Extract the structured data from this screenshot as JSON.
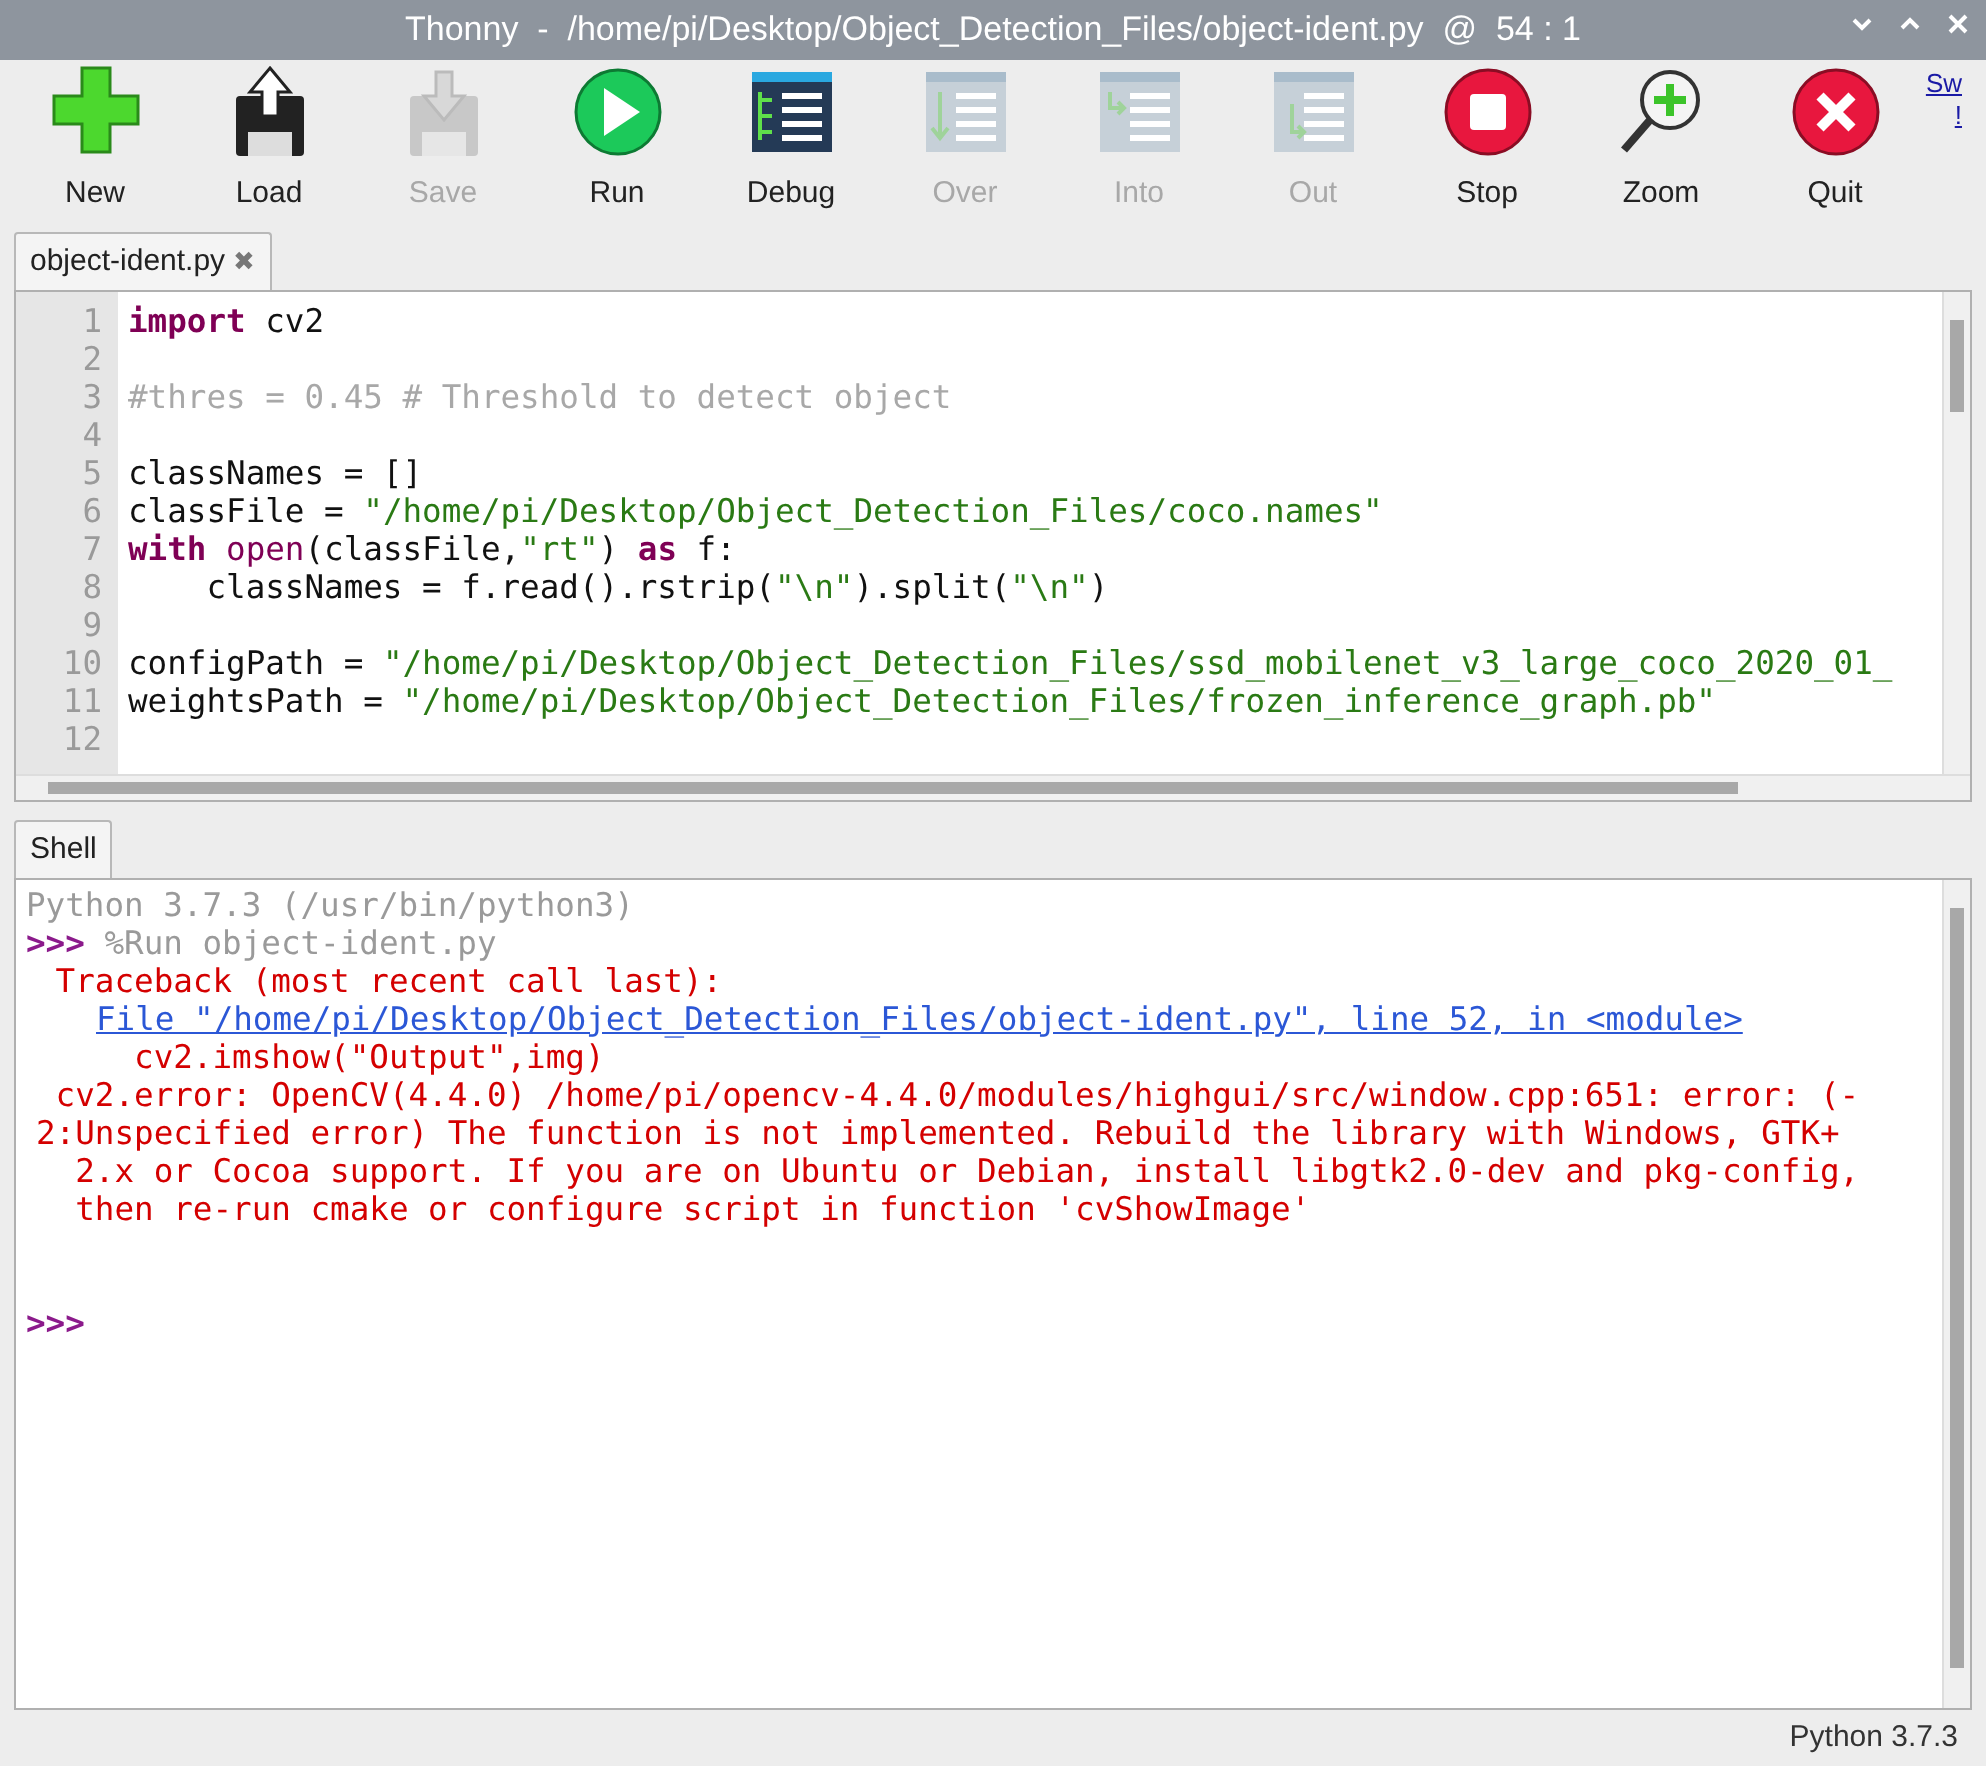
{
  "window": {
    "title": "Thonny  -  /home/pi/Desktop/Object_Detection_Files/object-ident.py  @  54 : 1"
  },
  "toolbar": [
    {
      "kind": "new",
      "label": "New",
      "disabled": false
    },
    {
      "kind": "load",
      "label": "Load",
      "disabled": false
    },
    {
      "kind": "save",
      "label": "Save",
      "disabled": true
    },
    {
      "kind": "run",
      "label": "Run",
      "disabled": false
    },
    {
      "kind": "debug",
      "label": "Debug",
      "disabled": false
    },
    {
      "kind": "over",
      "label": "Over",
      "disabled": true
    },
    {
      "kind": "into",
      "label": "Into",
      "disabled": true
    },
    {
      "kind": "out",
      "label": "Out",
      "disabled": true
    },
    {
      "kind": "stop",
      "label": "Stop",
      "disabled": false
    },
    {
      "kind": "zoom",
      "label": "Zoom",
      "disabled": false
    },
    {
      "kind": "quit",
      "label": "Quit",
      "disabled": false
    }
  ],
  "corner_link": [
    "Sw",
    "!"
  ],
  "editor": {
    "tabs": [
      {
        "label": "object-ident.py",
        "close": "✖",
        "selected": true
      }
    ],
    "lines": [
      {
        "number": "1",
        "tokens": [
          {
            "kind": "keyword",
            "text": "import"
          },
          {
            "kind": "plain",
            "text": " cv2"
          }
        ]
      },
      {
        "number": "2"
      },
      {
        "number": "3",
        "tokens": [
          {
            "kind": "comment",
            "text": "#thres = 0.45 # Threshold to detect object"
          }
        ]
      },
      {
        "number": "4"
      },
      {
        "number": "5",
        "tokens": [
          {
            "kind": "plain",
            "text": "classNames = []"
          }
        ]
      },
      {
        "number": "6",
        "tokens": [
          {
            "kind": "plain",
            "text": "classFile = "
          },
          {
            "kind": "string",
            "text": "\"/home/pi/Desktop/Object_Detection_Files/coco.names\""
          }
        ]
      },
      {
        "number": "7",
        "tokens": [
          {
            "kind": "keyword",
            "text": "with"
          },
          {
            "kind": "builtin",
            "text": " open"
          },
          {
            "kind": "plain",
            "text": "(classFile,"
          },
          {
            "kind": "string",
            "text": "\"rt\""
          },
          {
            "kind": "plain",
            "text": ") "
          },
          {
            "kind": "keyword",
            "text": "as"
          },
          {
            "kind": "plain",
            "text": " f:"
          }
        ]
      },
      {
        "number": "8",
        "tokens": [
          {
            "kind": "plain",
            "text": "    classNames = f.read().rstrip("
          },
          {
            "kind": "string",
            "text": "\"\\n\""
          },
          {
            "kind": "plain",
            "text": ").split("
          },
          {
            "kind": "string",
            "text": "\"\\n\""
          },
          {
            "kind": "plain",
            "text": ")"
          }
        ]
      },
      {
        "number": "9"
      },
      {
        "number": "10",
        "tokens": [
          {
            "kind": "plain",
            "text": "configPath = "
          },
          {
            "kind": "string",
            "text": "\"/home/pi/Desktop/Object_Detection_Files/ssd_mobilenet_v3_large_coco_2020_01_"
          }
        ]
      },
      {
        "number": "11",
        "tokens": [
          {
            "kind": "plain",
            "text": "weightsPath = "
          },
          {
            "kind": "string",
            "text": "\"/home/pi/Desktop/Object_Detection_Files/frozen_inference_graph.pb\""
          }
        ]
      },
      {
        "number": "12"
      }
    ]
  },
  "shell": {
    "tabs": [
      {
        "label": "Shell",
        "selected": true
      }
    ],
    "lines": [
      {
        "kind": "banner",
        "text": "Python 3.7.3 (/usr/bin/python3)"
      },
      {
        "kind": "command",
        "prompt": ">>>",
        "text": "%Run object-ident.py"
      },
      {
        "kind": "error",
        "text": " Traceback (most recent call last):"
      },
      {
        "kind": "link",
        "text": "File \"/home/pi/Desktop/Object_Detection_Files/object-ident.py\", line 52, in <module>"
      },
      {
        "kind": "error",
        "text": "     cv2.imshow(\"Output\",img)"
      },
      {
        "kind": "error",
        "text": " cv2.error: OpenCV(4.4.0) /home/pi/opencv-4.4.0/modules/highgui/src/window.cpp:651: error: (-"
      },
      {
        "kind": "error",
        "text": "2:Unspecified error) The function is not implemented. Rebuild the library with Windows, GTK+"
      },
      {
        "kind": "error",
        "text": "  2.x or Cocoa support. If you are on Ubuntu or Debian, install libgtk2.0-dev and pkg-config,"
      },
      {
        "kind": "error",
        "text": "  then re-run cmake or configure script in function 'cvShowImage'"
      },
      {
        "kind": "blank"
      },
      {
        "kind": "blank"
      },
      {
        "kind": "prompt",
        "prompt": ">>>"
      }
    ]
  },
  "status_bar": {
    "interpreter": "Python 3.7.3"
  }
}
